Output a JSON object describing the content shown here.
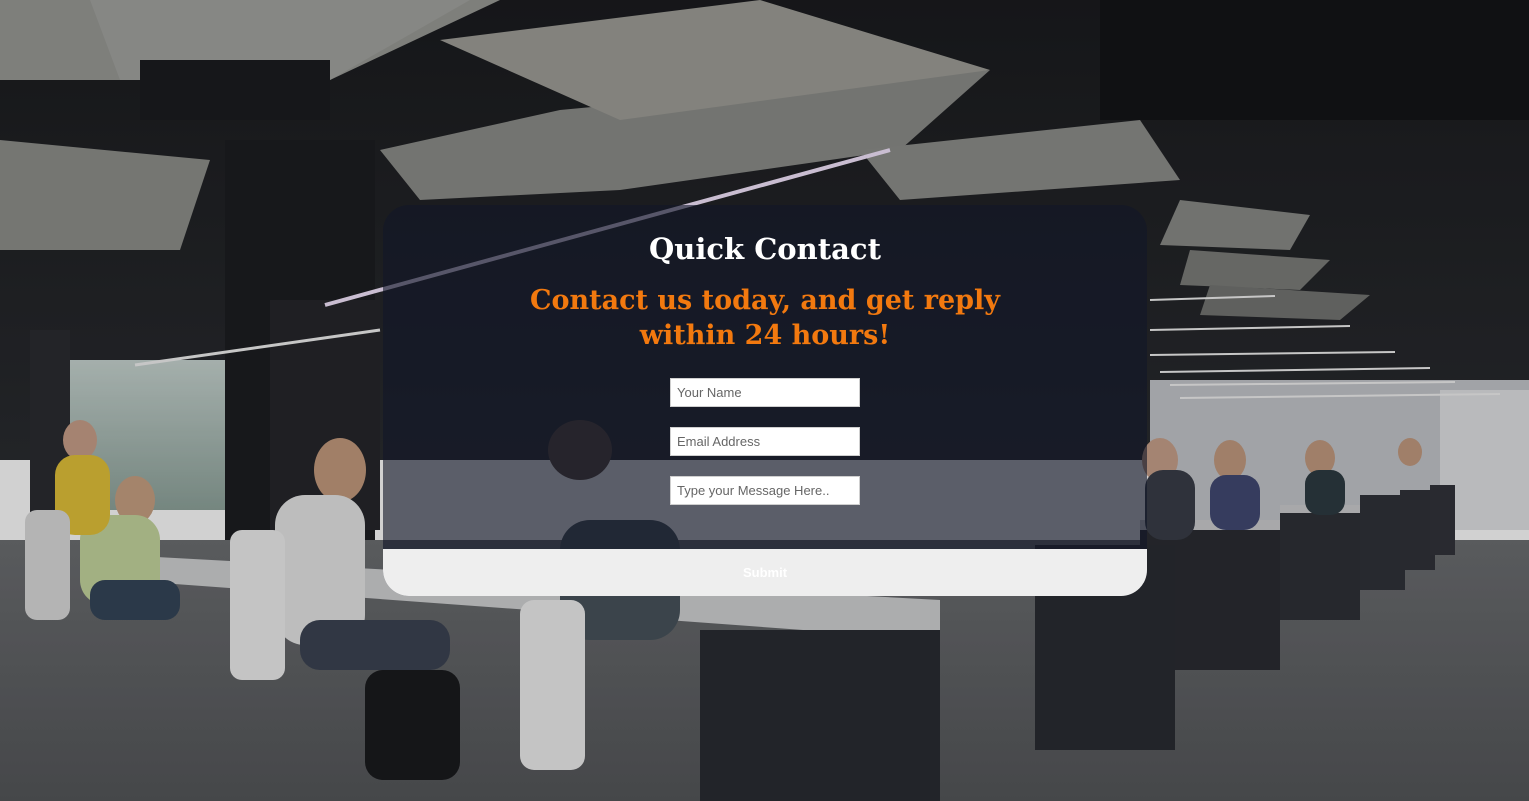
{
  "contact": {
    "title": "Quick Contact",
    "subtitle": "Contact us today, and get reply within 24 hours!",
    "fields": {
      "name_placeholder": "Your Name",
      "email_placeholder": "Email Address",
      "message_placeholder": "Type your Message Here.."
    },
    "submit_label": "Submit"
  },
  "colors": {
    "title": "#ffffff",
    "subtitle": "#f2790f",
    "submit_bar": "#eeeeee",
    "card_overlay": "rgba(18,22,40,0.62)"
  }
}
